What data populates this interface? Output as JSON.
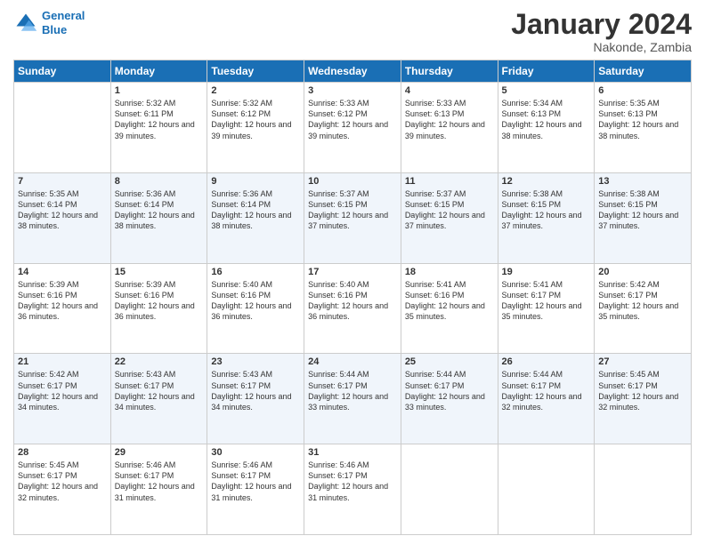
{
  "logo": {
    "line1": "General",
    "line2": "Blue"
  },
  "title": "January 2024",
  "subtitle": "Nakonde, Zambia",
  "days_header": [
    "Sunday",
    "Monday",
    "Tuesday",
    "Wednesday",
    "Thursday",
    "Friday",
    "Saturday"
  ],
  "weeks": [
    [
      {
        "day": "",
        "sunrise": "",
        "sunset": "",
        "daylight": ""
      },
      {
        "day": "1",
        "sunrise": "Sunrise: 5:32 AM",
        "sunset": "Sunset: 6:11 PM",
        "daylight": "Daylight: 12 hours and 39 minutes."
      },
      {
        "day": "2",
        "sunrise": "Sunrise: 5:32 AM",
        "sunset": "Sunset: 6:12 PM",
        "daylight": "Daylight: 12 hours and 39 minutes."
      },
      {
        "day": "3",
        "sunrise": "Sunrise: 5:33 AM",
        "sunset": "Sunset: 6:12 PM",
        "daylight": "Daylight: 12 hours and 39 minutes."
      },
      {
        "day": "4",
        "sunrise": "Sunrise: 5:33 AM",
        "sunset": "Sunset: 6:13 PM",
        "daylight": "Daylight: 12 hours and 39 minutes."
      },
      {
        "day": "5",
        "sunrise": "Sunrise: 5:34 AM",
        "sunset": "Sunset: 6:13 PM",
        "daylight": "Daylight: 12 hours and 38 minutes."
      },
      {
        "day": "6",
        "sunrise": "Sunrise: 5:35 AM",
        "sunset": "Sunset: 6:13 PM",
        "daylight": "Daylight: 12 hours and 38 minutes."
      }
    ],
    [
      {
        "day": "7",
        "sunrise": "Sunrise: 5:35 AM",
        "sunset": "Sunset: 6:14 PM",
        "daylight": "Daylight: 12 hours and 38 minutes."
      },
      {
        "day": "8",
        "sunrise": "Sunrise: 5:36 AM",
        "sunset": "Sunset: 6:14 PM",
        "daylight": "Daylight: 12 hours and 38 minutes."
      },
      {
        "day": "9",
        "sunrise": "Sunrise: 5:36 AM",
        "sunset": "Sunset: 6:14 PM",
        "daylight": "Daylight: 12 hours and 38 minutes."
      },
      {
        "day": "10",
        "sunrise": "Sunrise: 5:37 AM",
        "sunset": "Sunset: 6:15 PM",
        "daylight": "Daylight: 12 hours and 37 minutes."
      },
      {
        "day": "11",
        "sunrise": "Sunrise: 5:37 AM",
        "sunset": "Sunset: 6:15 PM",
        "daylight": "Daylight: 12 hours and 37 minutes."
      },
      {
        "day": "12",
        "sunrise": "Sunrise: 5:38 AM",
        "sunset": "Sunset: 6:15 PM",
        "daylight": "Daylight: 12 hours and 37 minutes."
      },
      {
        "day": "13",
        "sunrise": "Sunrise: 5:38 AM",
        "sunset": "Sunset: 6:15 PM",
        "daylight": "Daylight: 12 hours and 37 minutes."
      }
    ],
    [
      {
        "day": "14",
        "sunrise": "Sunrise: 5:39 AM",
        "sunset": "Sunset: 6:16 PM",
        "daylight": "Daylight: 12 hours and 36 minutes."
      },
      {
        "day": "15",
        "sunrise": "Sunrise: 5:39 AM",
        "sunset": "Sunset: 6:16 PM",
        "daylight": "Daylight: 12 hours and 36 minutes."
      },
      {
        "day": "16",
        "sunrise": "Sunrise: 5:40 AM",
        "sunset": "Sunset: 6:16 PM",
        "daylight": "Daylight: 12 hours and 36 minutes."
      },
      {
        "day": "17",
        "sunrise": "Sunrise: 5:40 AM",
        "sunset": "Sunset: 6:16 PM",
        "daylight": "Daylight: 12 hours and 36 minutes."
      },
      {
        "day": "18",
        "sunrise": "Sunrise: 5:41 AM",
        "sunset": "Sunset: 6:16 PM",
        "daylight": "Daylight: 12 hours and 35 minutes."
      },
      {
        "day": "19",
        "sunrise": "Sunrise: 5:41 AM",
        "sunset": "Sunset: 6:17 PM",
        "daylight": "Daylight: 12 hours and 35 minutes."
      },
      {
        "day": "20",
        "sunrise": "Sunrise: 5:42 AM",
        "sunset": "Sunset: 6:17 PM",
        "daylight": "Daylight: 12 hours and 35 minutes."
      }
    ],
    [
      {
        "day": "21",
        "sunrise": "Sunrise: 5:42 AM",
        "sunset": "Sunset: 6:17 PM",
        "daylight": "Daylight: 12 hours and 34 minutes."
      },
      {
        "day": "22",
        "sunrise": "Sunrise: 5:43 AM",
        "sunset": "Sunset: 6:17 PM",
        "daylight": "Daylight: 12 hours and 34 minutes."
      },
      {
        "day": "23",
        "sunrise": "Sunrise: 5:43 AM",
        "sunset": "Sunset: 6:17 PM",
        "daylight": "Daylight: 12 hours and 34 minutes."
      },
      {
        "day": "24",
        "sunrise": "Sunrise: 5:44 AM",
        "sunset": "Sunset: 6:17 PM",
        "daylight": "Daylight: 12 hours and 33 minutes."
      },
      {
        "day": "25",
        "sunrise": "Sunrise: 5:44 AM",
        "sunset": "Sunset: 6:17 PM",
        "daylight": "Daylight: 12 hours and 33 minutes."
      },
      {
        "day": "26",
        "sunrise": "Sunrise: 5:44 AM",
        "sunset": "Sunset: 6:17 PM",
        "daylight": "Daylight: 12 hours and 32 minutes."
      },
      {
        "day": "27",
        "sunrise": "Sunrise: 5:45 AM",
        "sunset": "Sunset: 6:17 PM",
        "daylight": "Daylight: 12 hours and 32 minutes."
      }
    ],
    [
      {
        "day": "28",
        "sunrise": "Sunrise: 5:45 AM",
        "sunset": "Sunset: 6:17 PM",
        "daylight": "Daylight: 12 hours and 32 minutes."
      },
      {
        "day": "29",
        "sunrise": "Sunrise: 5:46 AM",
        "sunset": "Sunset: 6:17 PM",
        "daylight": "Daylight: 12 hours and 31 minutes."
      },
      {
        "day": "30",
        "sunrise": "Sunrise: 5:46 AM",
        "sunset": "Sunset: 6:17 PM",
        "daylight": "Daylight: 12 hours and 31 minutes."
      },
      {
        "day": "31",
        "sunrise": "Sunrise: 5:46 AM",
        "sunset": "Sunset: 6:17 PM",
        "daylight": "Daylight: 12 hours and 31 minutes."
      },
      {
        "day": "",
        "sunrise": "",
        "sunset": "",
        "daylight": ""
      },
      {
        "day": "",
        "sunrise": "",
        "sunset": "",
        "daylight": ""
      },
      {
        "day": "",
        "sunrise": "",
        "sunset": "",
        "daylight": ""
      }
    ]
  ]
}
